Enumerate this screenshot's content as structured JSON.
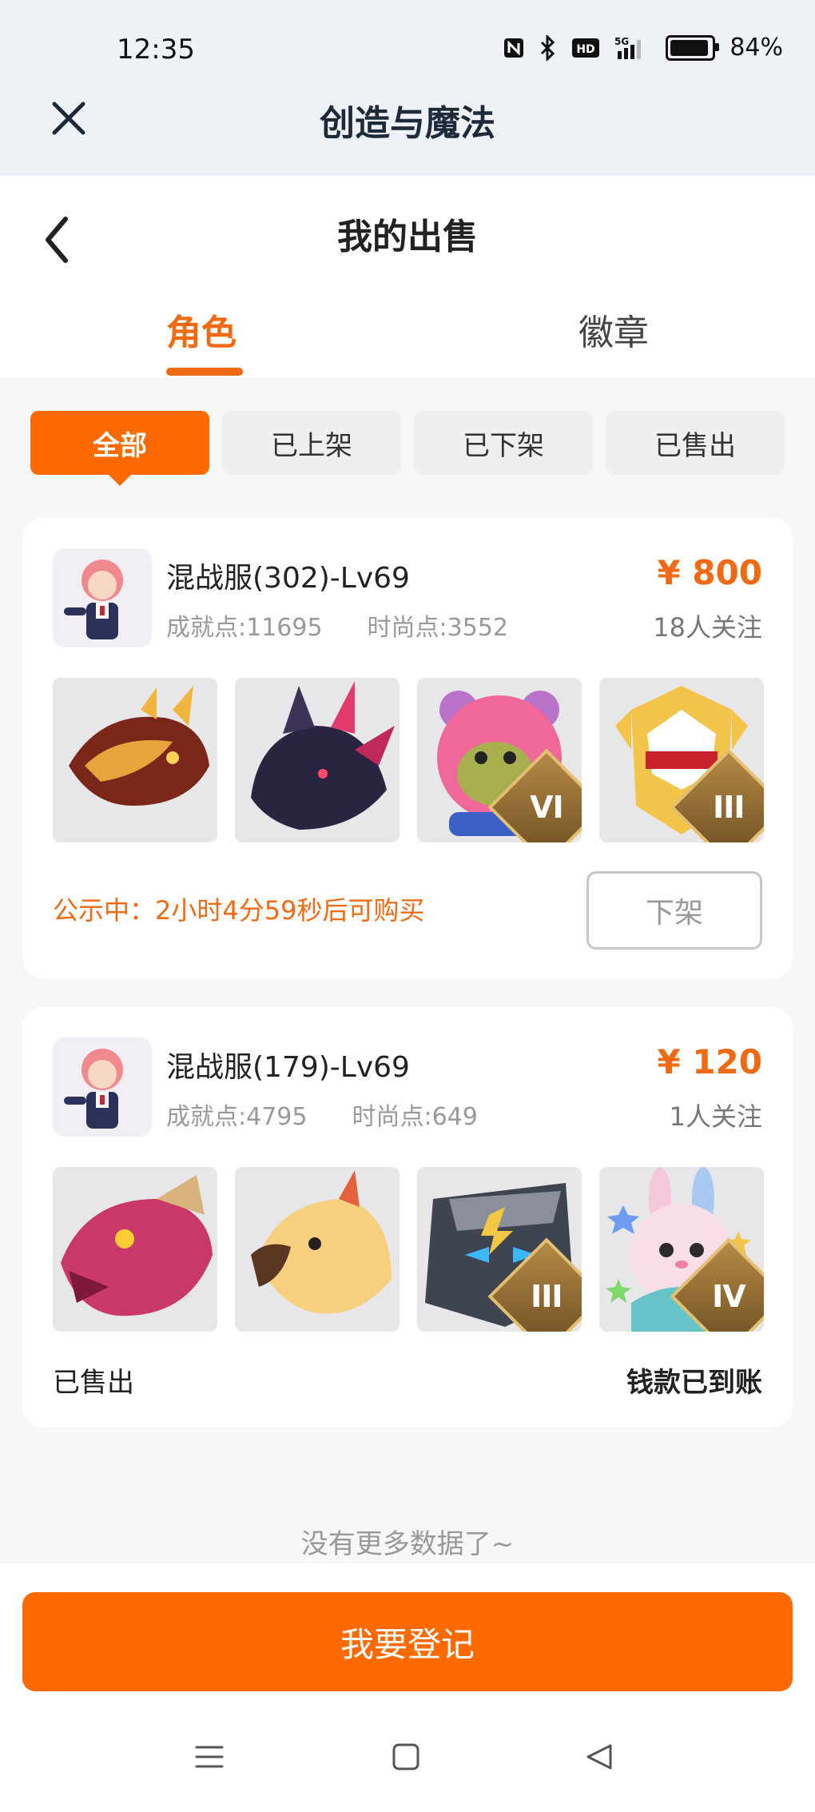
{
  "status": {
    "time": "12:35",
    "icons": [
      "nfc-icon",
      "bluetooth-icon",
      "hd-icon",
      "5g-signal-icon",
      "battery-icon"
    ],
    "battery": "84%"
  },
  "app": {
    "title": "创造与魔法"
  },
  "page": {
    "title": "我的出售"
  },
  "tabs": [
    {
      "label": "角色",
      "active": true
    },
    {
      "label": "徽章",
      "active": false
    }
  ],
  "filters": [
    {
      "label": "全部",
      "active": true
    },
    {
      "label": "已上架",
      "active": false
    },
    {
      "label": "已下架",
      "active": false
    },
    {
      "label": "已售出",
      "active": false
    }
  ],
  "listings": [
    {
      "server": "混战服(302)-Lv69",
      "achievement": "成就点:11695",
      "fashion": "时尚点:3552",
      "price": "¥ 800",
      "followers": "18人关注",
      "items": [
        {
          "icon": "fire-dragon-mount-icon",
          "badge": ""
        },
        {
          "icon": "dark-dragon-mount-icon",
          "badge": ""
        },
        {
          "icon": "pink-bear-mount-icon",
          "badge": "VI"
        },
        {
          "icon": "golden-helmet-mount-icon",
          "badge": "III"
        }
      ],
      "status_text": "公示中：2小时4分59秒后可购买",
      "action_label": "下架"
    },
    {
      "server": "混战服(179)-Lv69",
      "achievement": "成就点:4795",
      "fashion": "时尚点:649",
      "price": "¥ 120",
      "followers": "1人关注",
      "items": [
        {
          "icon": "red-dragon-mount-icon",
          "badge": ""
        },
        {
          "icon": "golden-bird-mount-icon",
          "badge": ""
        },
        {
          "icon": "stone-golem-mount-icon",
          "badge": "III"
        },
        {
          "icon": "pink-bunny-mount-icon",
          "badge": "IV"
        }
      ],
      "sold_label": "已售出",
      "money_label": "钱款已到账"
    }
  ],
  "footer": {
    "no_more": "没有更多数据了~",
    "register_label": "我要登记"
  },
  "colors": {
    "accent": "#ff6a00",
    "accent_text": "#ef6a12"
  }
}
